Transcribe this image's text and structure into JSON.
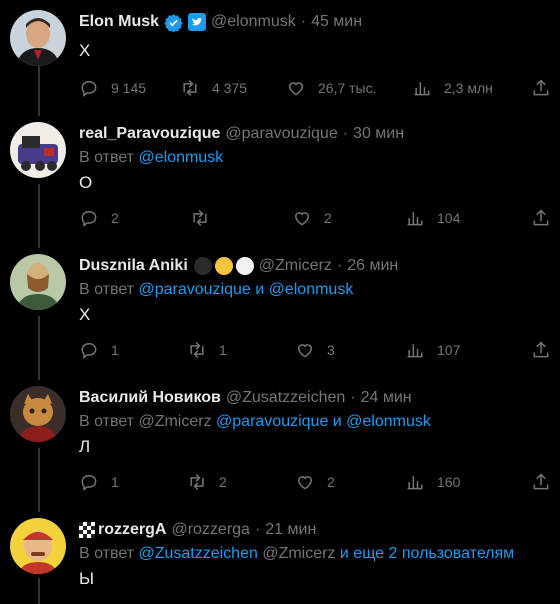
{
  "tweets": [
    {
      "name": "Elon Musk",
      "handle": "@elonmusk",
      "time": "45 мин",
      "text": "Х",
      "counts": {
        "reply": "9 145",
        "retweet": "4 375",
        "like": "26,7 тыс.",
        "views": "2,3 млн"
      }
    },
    {
      "name": "real_Paravouzique",
      "handle": "@paravouzique",
      "time": "30 мин",
      "reply_prefix": "В ответ",
      "reply_links": "@elonmusk",
      "text": "О",
      "counts": {
        "reply": "2",
        "retweet": "",
        "like": "2",
        "views": "104"
      }
    },
    {
      "name": "Dusznila Aniki",
      "handle": "@Zmicerz",
      "time": "26 мин",
      "reply_prefix": "В ответ",
      "reply_links": "@paravouzique и @elonmusk",
      "text": "Х",
      "counts": {
        "reply": "1",
        "retweet": "1",
        "like": "3",
        "views": "107"
      }
    },
    {
      "name": "Василий Новиков",
      "handle": "@Zusatzzeichen",
      "time": "24 мин",
      "reply_prefix": "В ответ @Zmicerz",
      "reply_links": "@paravouzique и @elonmusk",
      "text": "Л",
      "counts": {
        "reply": "1",
        "retweet": "2",
        "like": "2",
        "views": "160"
      }
    },
    {
      "name": "rozzergA",
      "handle": "@rozzerga",
      "time": "21 мин",
      "reply_prefix": "В ответ",
      "reply_links": "@Zusatzzeichen",
      "reply_mid": "@Zmicerz",
      "reply_more": "и еще 2 пользователям",
      "text": "Ы"
    }
  ],
  "colors": {
    "accent": "#1d9bf0",
    "muted": "#71767b",
    "text": "#e7e9ea",
    "bg": "#000000"
  }
}
